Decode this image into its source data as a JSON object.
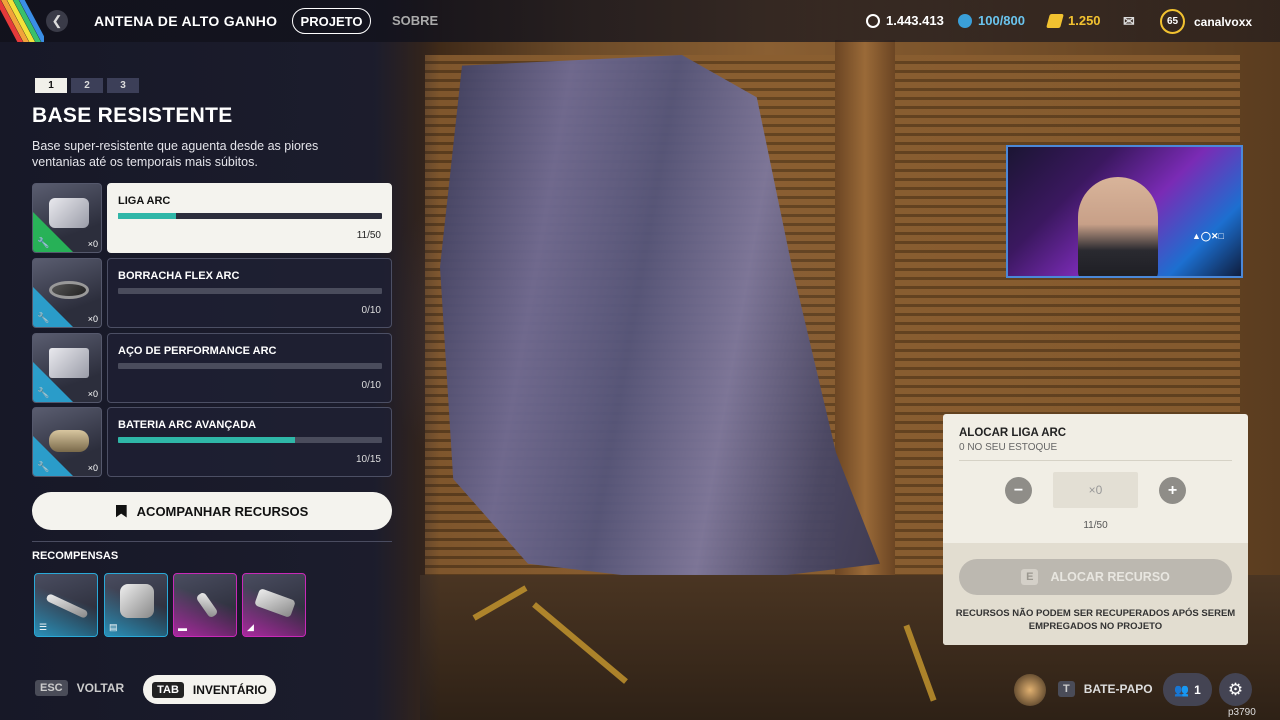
{
  "header": {
    "title": "ANTENA DE ALTO GANHO",
    "tabs": [
      {
        "label": "PROJETO",
        "active": true
      },
      {
        "label": "SOBRE",
        "active": false
      }
    ],
    "stats": {
      "credits": "1.443.413",
      "tokens": "100/800",
      "currency": "1.250"
    },
    "user": {
      "level": "65",
      "name": "canalvoxx"
    }
  },
  "project": {
    "steps": [
      "1",
      "2",
      "3"
    ],
    "active_step": 0,
    "title": "BASE RESISTENTE",
    "description": "Base super-resistente que aguenta desde as piores ventanias até os temporais mais súbitos.",
    "resources": [
      {
        "name": "LIGA ARC",
        "owned": "×0",
        "count": "11/50",
        "progress": 0.22,
        "tint": "#27c05a",
        "selected": true
      },
      {
        "name": "BORRACHA FLEX ARC",
        "owned": "×0",
        "count": "0/10",
        "progress": 0.0,
        "tint": "#2aa9d8",
        "selected": false
      },
      {
        "name": "AÇO DE PERFORMANCE ARC",
        "owned": "×0",
        "count": "0/10",
        "progress": 0.0,
        "tint": "#2aa9d8",
        "selected": false
      },
      {
        "name": "BATERIA ARC AVANÇADA",
        "owned": "×0",
        "count": "10/15",
        "progress": 0.67,
        "tint": "#2aa9d8",
        "selected": false
      }
    ],
    "track_button": "ACOMPANHAR RECURSOS",
    "rewards_label": "RECOMPENSAS",
    "rewards": [
      {
        "tint": "#2aa9d8"
      },
      {
        "tint": "#2aa9d8"
      },
      {
        "tint": "#c829b8"
      },
      {
        "tint": "#c829b8"
      }
    ]
  },
  "footer": {
    "back_key": "ESC",
    "back_label": "VOLTAR",
    "inventory_key": "TAB",
    "inventory_label": "INVENTÁRIO",
    "chat_key": "T",
    "chat_label": "BATE-PAPO",
    "party_count": "1",
    "corner_id": "p3790"
  },
  "allocation": {
    "title": "ALOCAR LIGA ARC",
    "subtitle": "0 NO SEU ESTOQUE",
    "quantity": "×0",
    "progress": "11/50",
    "button_key": "E",
    "button_label": "ALOCAR RECURSO",
    "warning": "RECURSOS NÃO PODEM SER RECUPERADOS APÓS SEREM EMPREGADOS NO PROJETO"
  },
  "colors": {
    "accent_teal": "#2fb7a8",
    "rare_blue": "#2aa9d8",
    "epic_magenta": "#c829b8",
    "uncommon_green": "#27c05a",
    "level_ring": "#f2c230"
  }
}
